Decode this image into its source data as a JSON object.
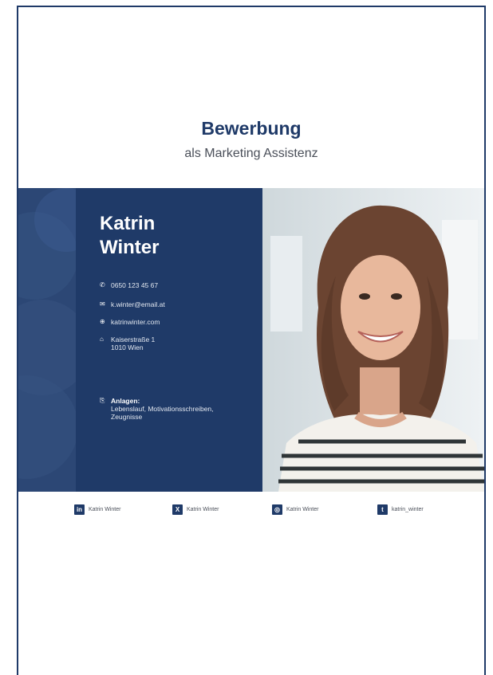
{
  "header": {
    "title": "Bewerbung",
    "subtitle": "als Marketing Assistenz"
  },
  "profile": {
    "first_name": "Katrin",
    "last_name": "Winter"
  },
  "contact": {
    "phone": "0650 123 45 67",
    "email": "k.winter@email.at",
    "website": "katrinwinter.com",
    "street": "Kaiserstraße 1",
    "city": "1010 Wien"
  },
  "attachments": {
    "label": "Anlagen:",
    "line1": "Lebenslauf, Motivationsschreiben,",
    "line2": "Zeugnisse"
  },
  "social": [
    {
      "icon": "linkedin-icon",
      "glyph": "in",
      "label": "Katrin Winter"
    },
    {
      "icon": "xing-icon",
      "glyph": "X",
      "label": "Katrin Winter"
    },
    {
      "icon": "instagram-icon",
      "glyph": "◎",
      "label": "Katrin Winter"
    },
    {
      "icon": "twitter-icon",
      "glyph": "t",
      "label": "katrin_winter"
    }
  ],
  "colors": {
    "navy": "#1f3a68",
    "deco": "#2c4775",
    "text": "#4a4f59"
  }
}
